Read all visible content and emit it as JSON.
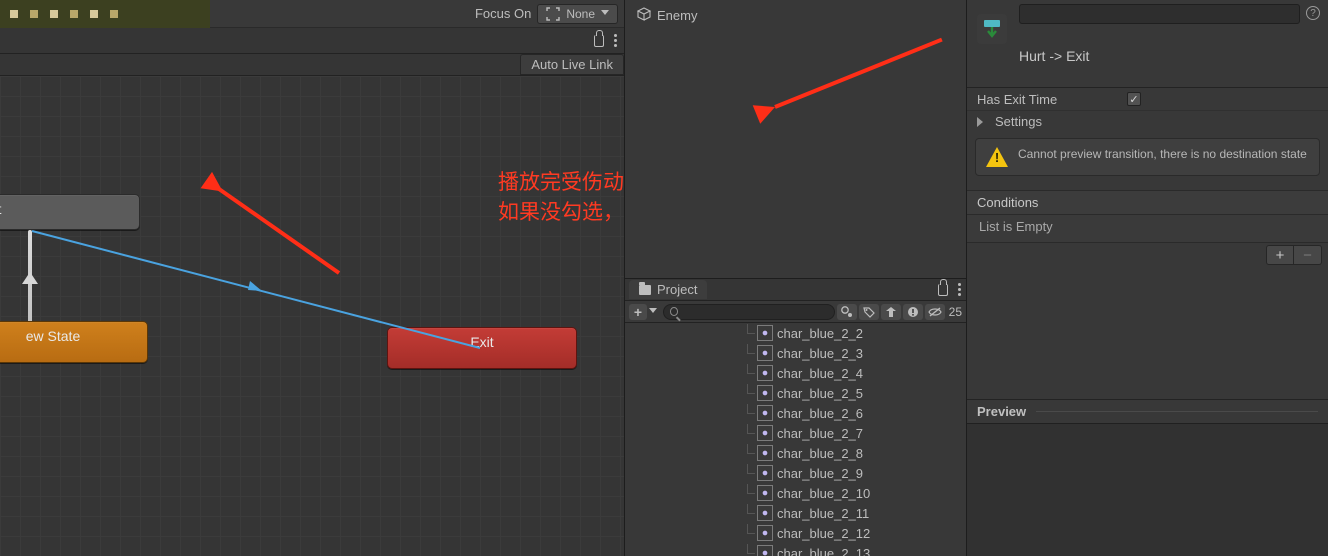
{
  "animator": {
    "focus_on": "Focus On",
    "focus_value": "None",
    "link_tab": "Auto Live Link",
    "nodes": {
      "hurt": "Hurt",
      "new_state": "ew State",
      "exit": "Exit"
    }
  },
  "annotation": {
    "line1": "播放完受伤动画后退出，",
    "line2": "如果没勾选，不会播放受伤动画"
  },
  "hierarchy": {
    "enemy": "Enemy"
  },
  "project": {
    "tab": "Project",
    "search_placeholder": "",
    "hidden_count": "25",
    "items": [
      "char_blue_2_2",
      "char_blue_2_3",
      "char_blue_2_4",
      "char_blue_2_5",
      "char_blue_2_6",
      "char_blue_2_7",
      "char_blue_2_8",
      "char_blue_2_9",
      "char_blue_2_10",
      "char_blue_2_11",
      "char_blue_2_12",
      "char_blue_2_13"
    ]
  },
  "inspector": {
    "transition_title": "Hurt -> Exit",
    "has_exit_time_label": "Has Exit Time",
    "has_exit_time_checked": true,
    "settings_label": "Settings",
    "warning": "Cannot preview transition, there is no destination state",
    "conditions_header": "Conditions",
    "conditions_empty": "List is Empty",
    "preview_label": "Preview",
    "help": "?"
  }
}
